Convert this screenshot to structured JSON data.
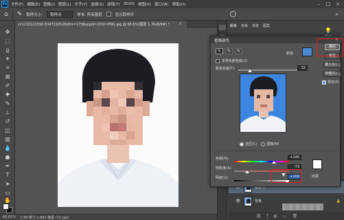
{
  "app": {
    "logo": "Ps",
    "menu": [
      "文件(F)",
      "编辑(E)",
      "图像(I)",
      "图层(L)",
      "文字(Y)",
      "选择(S)",
      "滤镜(T)",
      "3D(D)",
      "视图(V)",
      "窗口(W)",
      "帮助(H)"
    ]
  },
  "options": {
    "sample_label": "取样大小:",
    "sample_value": "取样点",
    "sample_tail": "样本: 所有图层",
    "show_ring": "显示取样环"
  },
  "document": {
    "tab_title": "cc1132121550.6347216528dfm=1758appid=255t=PNG.jpg @ 66.6%(图层 1, RGB/8#) *",
    "tab_close": "×"
  },
  "status": {
    "zoom": "66.61%",
    "doc_info": "2.48 英寸 x 882 像素 (72 ppi)"
  },
  "dock": {
    "tabs": [
      "颜色",
      "色板",
      "渐变",
      "图案"
    ],
    "learn_label": "学习"
  },
  "layers": {
    "items": [
      {
        "name": "图层 1",
        "selected": true
      },
      {
        "name": "背景",
        "selected": false,
        "lock": "🔒"
      }
    ]
  },
  "dialog": {
    "title": "替换颜色",
    "close": "×",
    "eyedroppers": [
      "eyedropper",
      "eyedropper-plus",
      "eyedropper-minus"
    ],
    "color_label": "颜色:",
    "color_value": "#4b8ad3",
    "localized_label": "本地化颜色簇(Z)",
    "fuzziness_label": "颜色容差(F):",
    "fuzziness_value": "32",
    "selection_label": "选区(C)",
    "image_label": "图像(M)",
    "hue_label": "色相(H):",
    "hue_value": "+145",
    "saturation_label": "饱和度(A):",
    "saturation_value": "-73",
    "lightness_label": "明度(G):",
    "lightness_value": "+100",
    "result_label": "结果",
    "buttons": {
      "ok": "确定",
      "reset": "复位",
      "load": "载入(L)...",
      "save": "存储(S)...",
      "preview": "预览(P)"
    }
  }
}
